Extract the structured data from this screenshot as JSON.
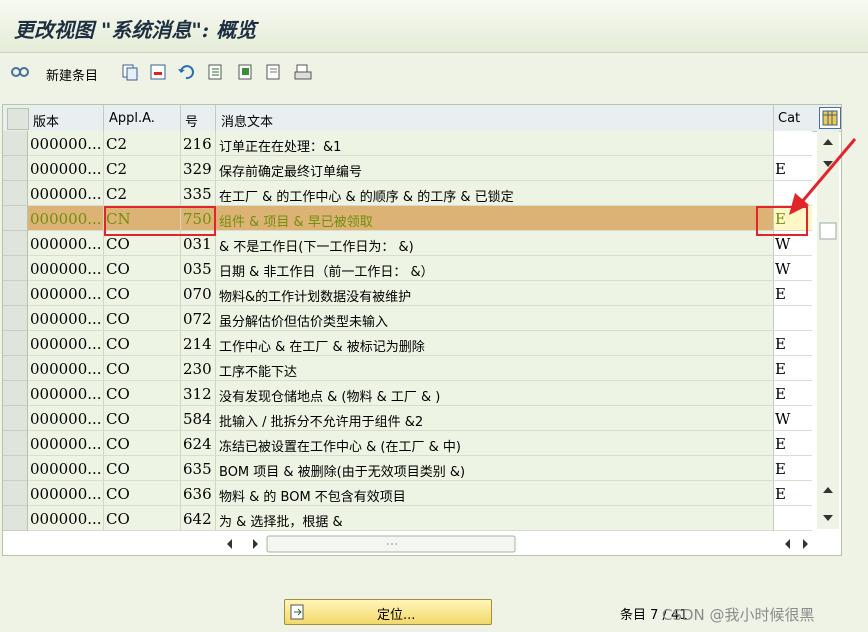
{
  "window": {
    "title": "更改视图 \"系统消息\": 概览"
  },
  "toolbar": {
    "new_entries_label": "新建条目"
  },
  "table": {
    "headers": {
      "version": "版本",
      "appl_area": "Appl.A.",
      "number": "号",
      "message_text": "消息文本",
      "category": "Cat"
    },
    "rows": [
      {
        "version": "000000...",
        "appl": "C2",
        "num": "216",
        "text": "订单正在在处理：&1",
        "cat": ""
      },
      {
        "version": "000000...",
        "appl": "C2",
        "num": "329",
        "text": "保存前确定最终订单编号",
        "cat": "E"
      },
      {
        "version": "000000...",
        "appl": "C2",
        "num": "335",
        "text": "在工厂 & 的工作中心 & 的顺序 & 的工序 & 已锁定",
        "cat": ""
      },
      {
        "version": "000000...",
        "appl": "CN",
        "num": "750",
        "text": "组件 & 项目 & 早已被领取",
        "cat": "E"
      },
      {
        "version": "000000...",
        "appl": "CO",
        "num": "031",
        "text": "& 不是工作日(下一工作日为： &)",
        "cat": "W"
      },
      {
        "version": "000000...",
        "appl": "CO",
        "num": "035",
        "text": "日期 & 非工作日（前一工作日： &）",
        "cat": "W"
      },
      {
        "version": "000000...",
        "appl": "CO",
        "num": "070",
        "text": "物料&的工作计划数据没有被维护",
        "cat": "E"
      },
      {
        "version": "000000...",
        "appl": "CO",
        "num": "072",
        "text": "虽分解估价但估价类型未输入",
        "cat": ""
      },
      {
        "version": "000000...",
        "appl": "CO",
        "num": "214",
        "text": "工作中心 & 在工厂 & 被标记为删除",
        "cat": "E"
      },
      {
        "version": "000000...",
        "appl": "CO",
        "num": "230",
        "text": "工序不能下达",
        "cat": "E"
      },
      {
        "version": "000000...",
        "appl": "CO",
        "num": "312",
        "text": "没有发现仓储地点 & (物料 & 工厂 & )",
        "cat": "E"
      },
      {
        "version": "000000...",
        "appl": "CO",
        "num": "584",
        "text": "批输入 / 批拆分不允许用于组件 &2",
        "cat": "W"
      },
      {
        "version": "000000...",
        "appl": "CO",
        "num": "624",
        "text": "冻结已被设置在工作中心 & (在工厂 & 中)",
        "cat": "E"
      },
      {
        "version": "000000...",
        "appl": "CO",
        "num": "635",
        "text": "BOM 项目 & 被删除(由于无效项目类别 &)",
        "cat": "E"
      },
      {
        "version": "000000...",
        "appl": "CO",
        "num": "636",
        "text": "物料 & 的 BOM 不包含有效项目",
        "cat": "E"
      },
      {
        "version": "000000...",
        "appl": "CO",
        "num": "642",
        "text": "为 & 选择批，根据 &",
        "cat": ""
      }
    ]
  },
  "footer": {
    "locate_button": "定位...",
    "status": "条目 7 / 41",
    "watermark": "CSDN @我小时候很黑"
  },
  "colors": {
    "highlight_row": "#dcb374",
    "annotation_red": "#e0262a",
    "table_bg": "#edf4e3"
  }
}
